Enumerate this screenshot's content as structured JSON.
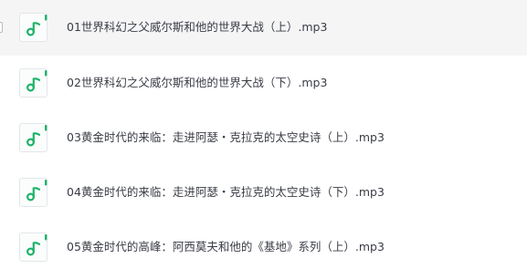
{
  "file_list": {
    "files": [
      {
        "name": "01世界科幻之父威尔斯和他的世界大战（上）.mp3",
        "icon": "music-note-icon"
      },
      {
        "name": "02世界科幻之父威尔斯和他的世界大战（下）.mp3",
        "icon": "music-note-icon"
      },
      {
        "name": "03黄金时代的来临：走进阿瑟・克拉克的太空史诗（上）.mp3",
        "icon": "music-note-icon"
      },
      {
        "name": "04黄金时代的来临：走进阿瑟・克拉克的太空史诗（下）.mp3",
        "icon": "music-note-icon"
      },
      {
        "name": "05黄金时代的高峰：阿西莫夫和他的《基地》系列（上）.mp3",
        "icon": "music-note-icon"
      }
    ]
  },
  "colors": {
    "icon_green": "#1fb36b",
    "hover_row_bg": "#f5f5f6",
    "text": "#3a3d45"
  }
}
